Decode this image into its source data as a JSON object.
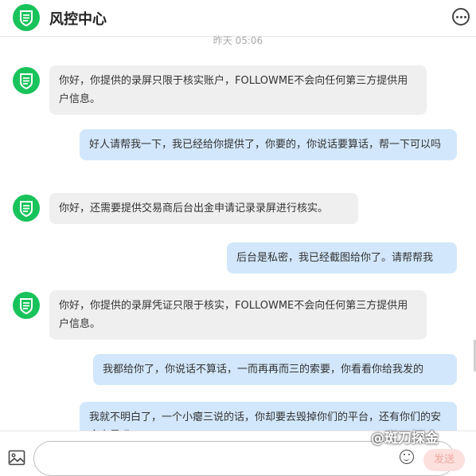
{
  "header": {
    "title": "风控中心",
    "more_icon": "more-icon"
  },
  "timestamp": "昨天 05:06",
  "colors": {
    "brand_green": "#19c35b",
    "incoming_bubble": "#efefef",
    "outgoing_bubble": "#d2e7fb",
    "send_disabled": "#fbe0de"
  },
  "messages": [
    {
      "from": "support",
      "text": "你好，你提供的录屏只限于核实账户，FOLLOWME不会向任何第三方提供用户信息。"
    },
    {
      "from": "user",
      "text": "好人请帮我一下，我已经给你提供了，你要的，你说话要算话，帮一下可以吗"
    },
    {
      "from": "support",
      "text": "你好，还需要提供交易商后台出金申请记录录屏进行核实。"
    },
    {
      "from": "user",
      "text": "后台是私密，我已经截图给你了。请帮帮我"
    },
    {
      "from": "support",
      "text": "你好，你提供的录屏凭证只限于核实，FOLLOWME不会向任何第三方提供用户信息。"
    },
    {
      "from": "user",
      "text": "我都给你了，你说话不算话，一而再再而三的索要，你看看你给我发的"
    },
    {
      "from": "user",
      "text": "我就不明白了，一个小瘪三说的话，你却要去毁掉你们的平台，还有你们的安全安是吗"
    }
  ],
  "composer": {
    "placeholder": "",
    "send_label": "发送"
  },
  "watermark": "@斑刀探金"
}
